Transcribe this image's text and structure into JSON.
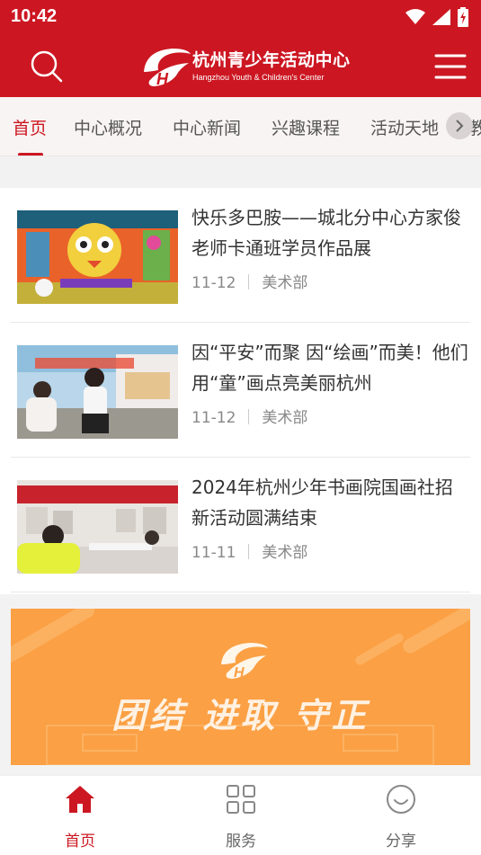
{
  "status_bar": {
    "time": "10:42"
  },
  "header": {
    "logo_cn": "杭州青少年活动中心",
    "logo_en": "Hangzhou Youth & Children's Center"
  },
  "tabs": [
    {
      "label": "首页",
      "active": true
    },
    {
      "label": "中心概况"
    },
    {
      "label": "中心新闻"
    },
    {
      "label": "兴趣课程"
    },
    {
      "label": "活动天地"
    },
    {
      "label": "教"
    }
  ],
  "news": [
    {
      "title": "快乐多巴胺——城北分中心方家俊老师卡通班学员作品展",
      "date": "11-12",
      "department": "美术部"
    },
    {
      "title": "因“平安”而聚 因“绘画”而美！他们用“童”画点亮美丽杭州",
      "date": "11-12",
      "department": "美术部"
    },
    {
      "title": "2024年杭州少年书画院国画社招新活动圆满结束",
      "date": "11-11",
      "department": "美术部"
    }
  ],
  "banner": {
    "text": "团结  进取  守正"
  },
  "bottom_nav": [
    {
      "label": "首页",
      "icon": "home-icon",
      "active": true
    },
    {
      "label": "服务",
      "icon": "grid-icon"
    },
    {
      "label": "分享",
      "icon": "smile-icon"
    }
  ],
  "colors": {
    "brand_red": "#cc1722",
    "banner_orange": "#fba044"
  }
}
